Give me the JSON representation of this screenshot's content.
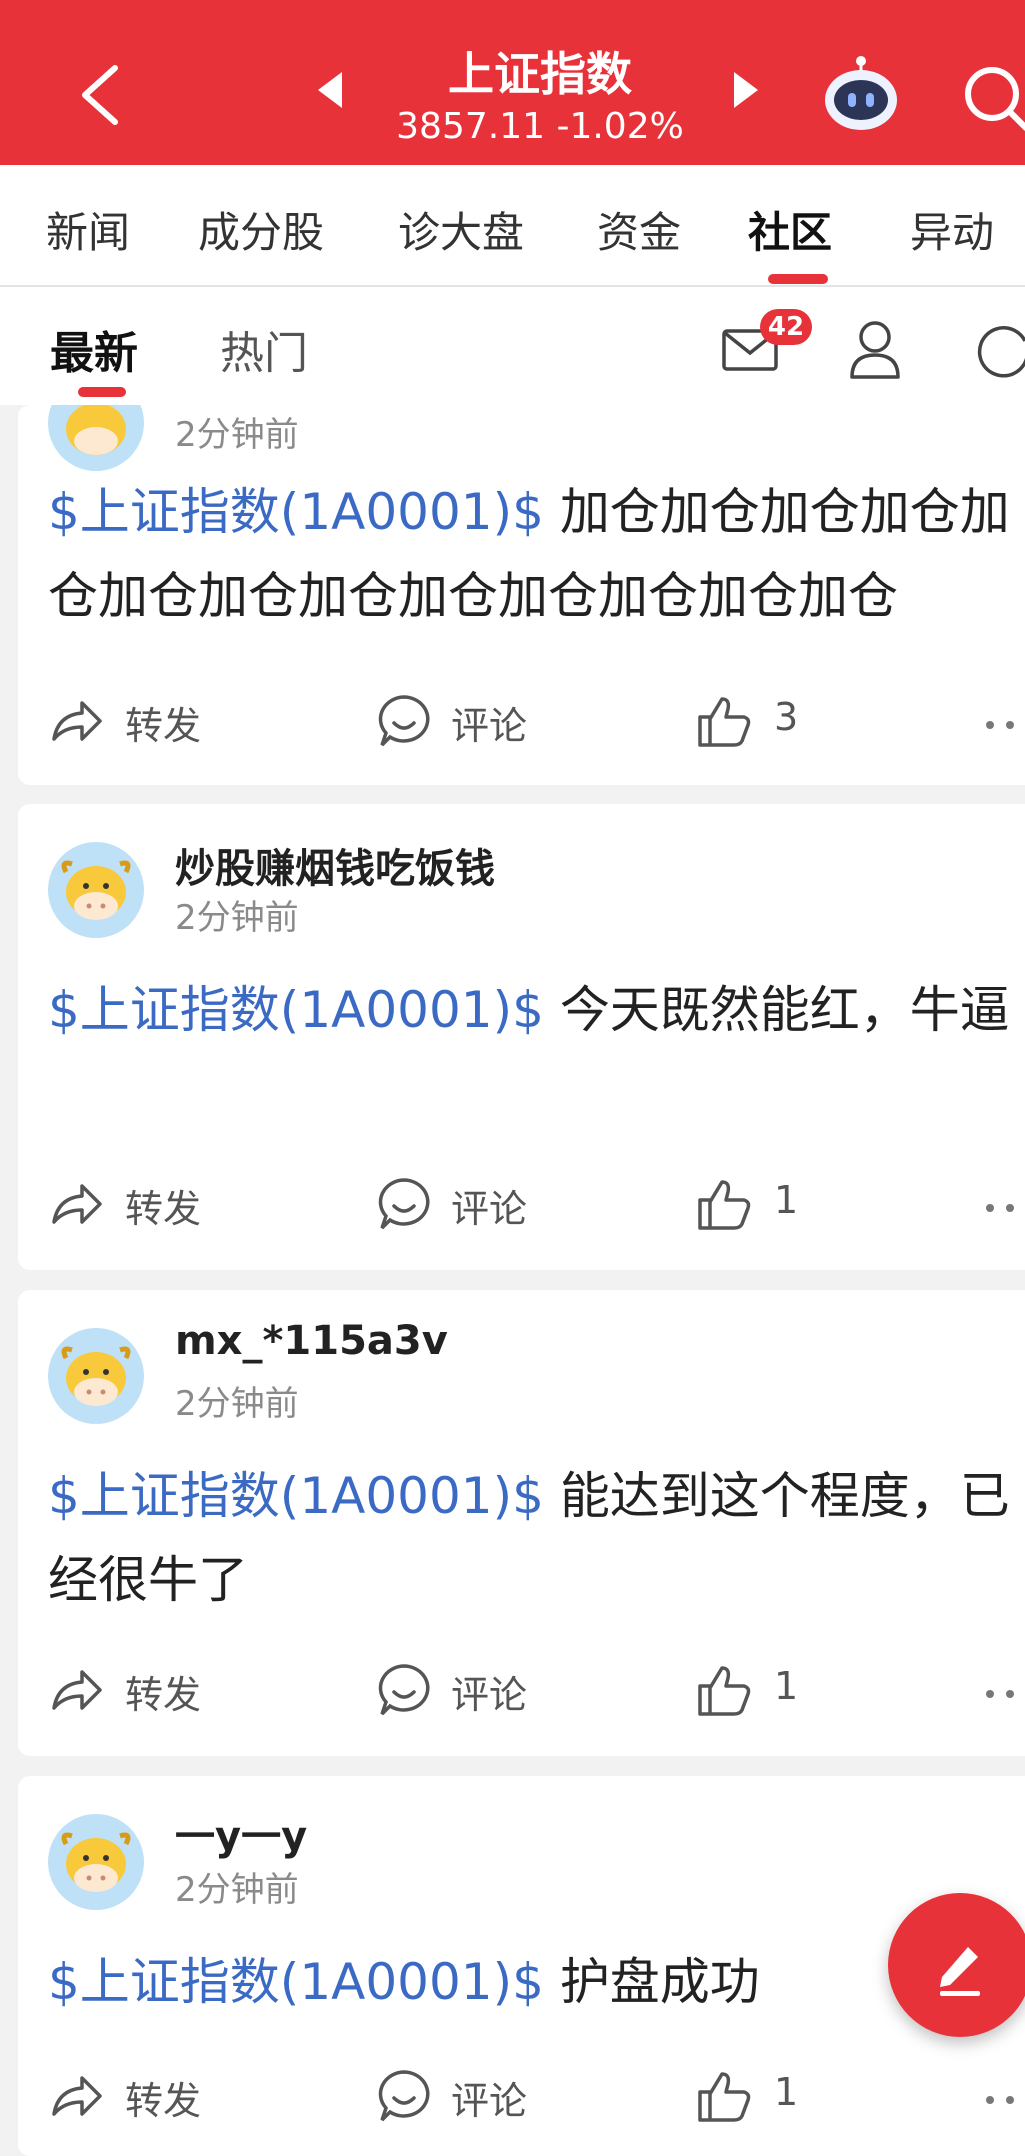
{
  "header": {
    "title": "上证指数",
    "subtitle": "3857.11 -1.02%"
  },
  "tabs": [
    {
      "label": "新闻"
    },
    {
      "label": "成分股"
    },
    {
      "label": "诊大盘"
    },
    {
      "label": "资金"
    },
    {
      "label": "社区"
    },
    {
      "label": "异动"
    }
  ],
  "subtabs": {
    "latest": "最新",
    "hot": "热门",
    "message_count": "42"
  },
  "actions": {
    "share": "转发",
    "comment": "评论"
  },
  "posts": [
    {
      "username": "",
      "time": "2分钟前",
      "tag": "$上证指数(1A0001)$",
      "text": "加仓加仓加仓加仓加仓加仓加仓加仓加仓加仓加仓加仓加仓",
      "likes": "3"
    },
    {
      "username": "炒股赚烟钱吃饭钱",
      "time": "2分钟前",
      "tag": "$上证指数(1A0001)$",
      "text": "今天既然能红，牛逼",
      "likes": "1"
    },
    {
      "username": "mx_*115a3v",
      "time": "2分钟前",
      "tag": "$上证指数(1A0001)$",
      "text": "能达到这个程度，已经很牛了",
      "likes": "1"
    },
    {
      "username": "一y一y",
      "time": "2分钟前",
      "tag": "$上证指数(1A0001)$",
      "text": "护盘成功",
      "likes": "1"
    }
  ],
  "colors": {
    "brand_red": "#e8323a",
    "tag_blue": "#3b6ac4"
  }
}
